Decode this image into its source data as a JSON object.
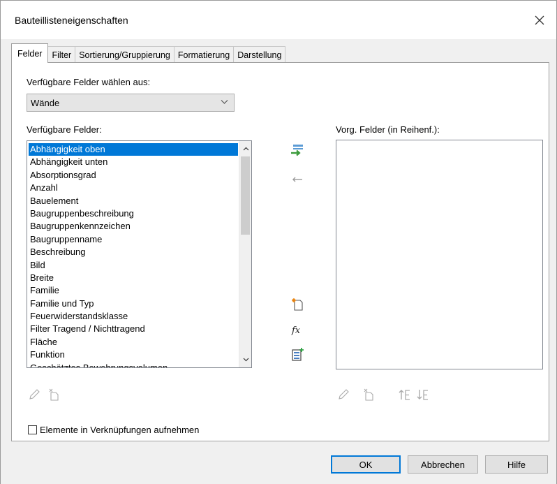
{
  "window": {
    "title": "Bauteillisteneigenschaften"
  },
  "tabs": [
    {
      "label": "Felder",
      "active": true
    },
    {
      "label": "Filter",
      "active": false
    },
    {
      "label": "Sortierung/Gruppierung",
      "active": false
    },
    {
      "label": "Formatierung",
      "active": false
    },
    {
      "label": "Darstellung",
      "active": false
    }
  ],
  "fields_panel": {
    "category_label": "Verfügbare Felder wählen aus:",
    "category_value": "Wände",
    "available_label": "Verfügbare Felder:",
    "scheduled_label": "Vorg. Felder (in Reihenf.):",
    "available_fields": [
      "Abhängigkeit oben",
      "Abhängigkeit unten",
      "Absorptionsgrad",
      "Anzahl",
      "Bauelement",
      "Baugruppenbeschreibung",
      "Baugruppenkennzeichen",
      "Baugruppenname",
      "Beschreibung",
      "Bild",
      "Breite",
      "Familie",
      "Familie und Typ",
      "Feuerwiderstandsklasse",
      "Filter Tragend / Nichttragend",
      "Fläche",
      "Funktion",
      "Geschätztes Bewehrungsvolumen"
    ],
    "selected_field": "Abhängigkeit oben",
    "scheduled_fields": [],
    "include_linked_label": "Elemente in Verknüpfungen aufnehmen",
    "include_linked_checked": false
  },
  "icons": {
    "add_field": "add-parameter-icon",
    "remove_field": "remove-parameter-icon",
    "new_parameter": "new-parameter-icon",
    "calculated_value": "calculated-value-icon",
    "combine_parameters": "combine-parameters-icon",
    "edit": "edit-icon",
    "delete": "delete-icon",
    "move_up": "move-up-icon",
    "move_down": "move-down-icon",
    "formula_glyph": "fx"
  },
  "buttons": {
    "ok": "OK",
    "cancel": "Abbrechen",
    "help": "Hilfe"
  },
  "colors": {
    "selection": "#0078d7",
    "default_button_border": "#0078d7"
  }
}
